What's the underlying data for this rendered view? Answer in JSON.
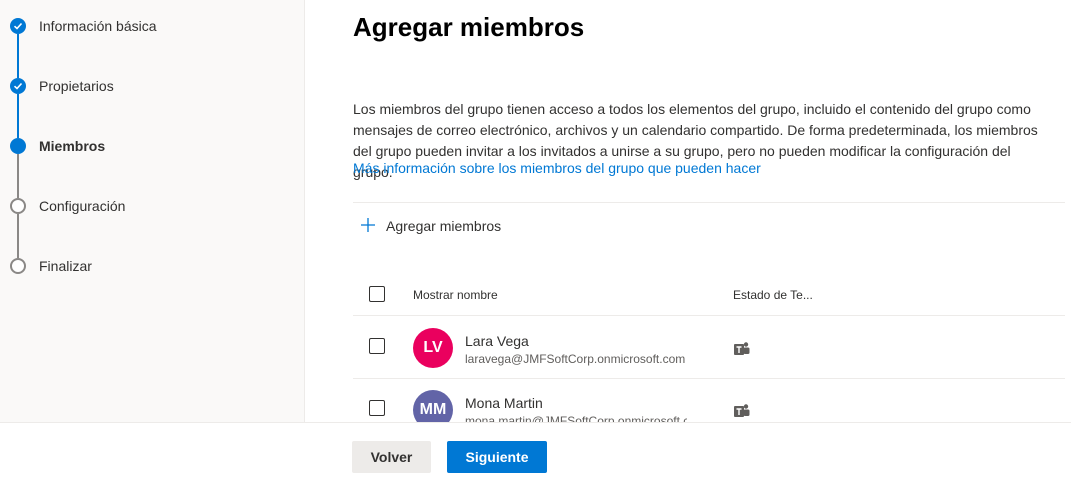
{
  "stepper": {
    "steps": [
      {
        "label": "Información básica",
        "state": "done"
      },
      {
        "label": "Propietarios",
        "state": "done"
      },
      {
        "label": "Miembros",
        "state": "current"
      },
      {
        "label": "Configuración",
        "state": "todo"
      },
      {
        "label": "Finalizar",
        "state": "todo"
      }
    ]
  },
  "main": {
    "title": "Agregar miembros",
    "description": "Los miembros del grupo tienen acceso a todos los elementos del grupo, incluido el contenido del grupo como mensajes de correo electrónico, archivos y un calendario compartido. De forma predeterminada, los miembros del grupo pueden invitar a los invitados a unirse a su grupo, pero no pueden modificar la configuración del grupo.",
    "learn_more_link": "Más información sobre los miembros del grupo que pueden hacer",
    "add_members_label": "Agregar miembros"
  },
  "table": {
    "columns": [
      "Mostrar nombre",
      "Estado de Te..."
    ],
    "rows": [
      {
        "initials": "LV",
        "name": "Lara Vega",
        "email": "laravega@JMFSoftCorp.onmicrosoft.com",
        "avatar_color": "#ea005e",
        "status_icon": "teams-icon"
      },
      {
        "initials": "MM",
        "name": "Mona Martin",
        "email": "mona.martin@JMFSoftCorp.onmicrosoft.c",
        "avatar_color": "#6264a7",
        "status_icon": "teams-icon"
      }
    ]
  },
  "footer": {
    "back_label": "Volver",
    "next_label": "Siguiente"
  },
  "colors": {
    "accent": "#0078d4",
    "panel_bg": "#faf9f8"
  }
}
